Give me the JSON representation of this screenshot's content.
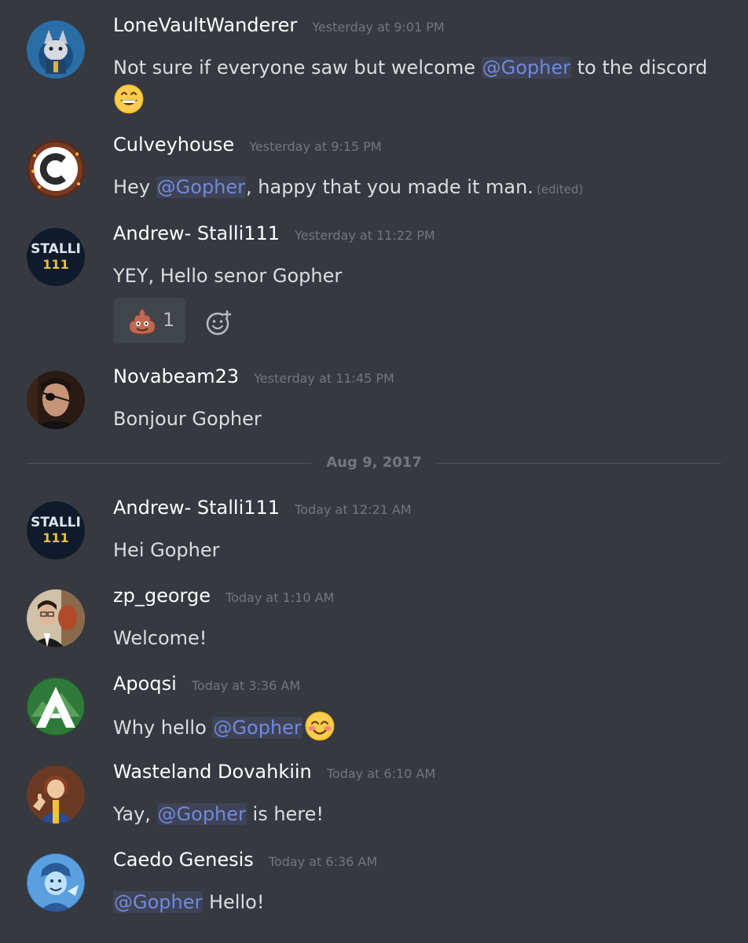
{
  "divider": {
    "date": "Aug 9, 2017"
  },
  "messages": [
    {
      "username": "LoneVaultWanderer",
      "timestamp": "Yesterday at 9:01 PM",
      "text_before": "Not sure if everyone saw but welcome ",
      "mention": "@Gopher",
      "text_after": " to the discord",
      "emoji": "grinning-emoji"
    },
    {
      "username": "Culveyhouse",
      "timestamp": "Yesterday at 9:15 PM",
      "text_before": "Hey ",
      "mention": "@Gopher",
      "text_after": ", happy that you made it man.",
      "edited": "(edited)"
    },
    {
      "username": "Andrew- Stalli111",
      "timestamp": "Yesterday at 11:22 PM",
      "text": "YEY, Hello senor Gopher",
      "reaction": {
        "emoji": "poop-emoji",
        "count": "1"
      },
      "avatar_text": [
        "STALLI",
        "111"
      ]
    },
    {
      "username": "Novabeam23",
      "timestamp": "Yesterday at 11:45 PM",
      "text": "Bonjour Gopher"
    },
    {
      "username": "Andrew- Stalli111",
      "timestamp": "Today at 12:21 AM",
      "text": "Hei Gopher",
      "avatar_text": [
        "STALLI",
        "111"
      ]
    },
    {
      "username": "zp_george",
      "timestamp": "Today at 1:10 AM",
      "text": "Welcome!"
    },
    {
      "username": "Apoqsi",
      "timestamp": "Today at 3:36 AM",
      "text_before": "Why hello ",
      "mention": "@Gopher",
      "emoji": "blush-emoji"
    },
    {
      "username": "Wasteland Dovahkiin",
      "timestamp": "Today at 6:10 AM",
      "text_before": "Yay, ",
      "mention": "@Gopher",
      "text_after": " is here!"
    },
    {
      "username": "Caedo Genesis",
      "timestamp": "Today at 6:36 AM",
      "mention": "@Gopher",
      "text_after": " Hello!"
    }
  ],
  "colors": {
    "background": "#36393f",
    "username": "#ffffff",
    "timestamp": "#72767d",
    "text": "#dcddde",
    "mention": "#7289da",
    "reaction_bg": "#40444b"
  }
}
